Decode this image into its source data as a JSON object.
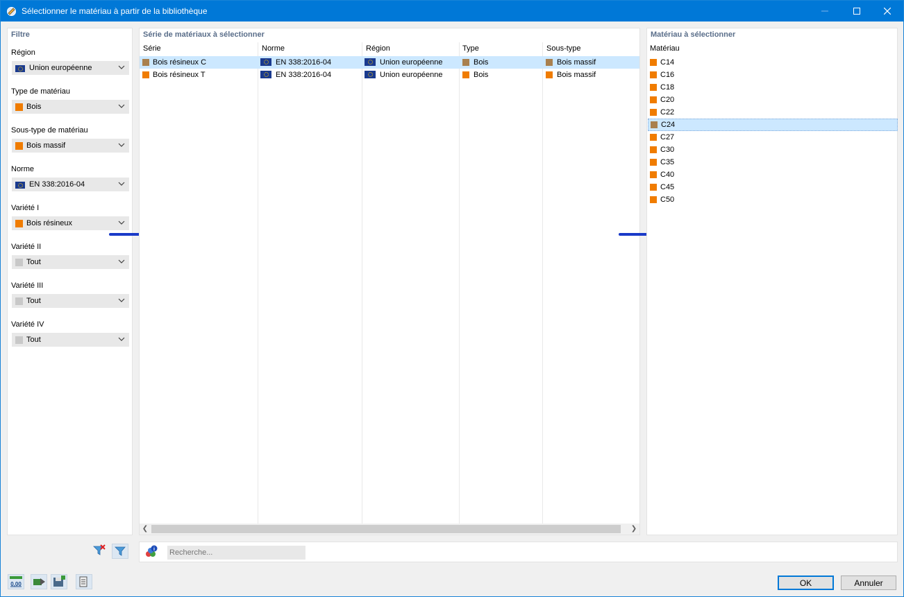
{
  "window": {
    "title": "Sélectionner le matériau à partir de la bibliothèque"
  },
  "filter": {
    "title": "Filtre",
    "fields": [
      {
        "label": "Région",
        "value": "Union européenne",
        "icon": "eu-flag-icon"
      },
      {
        "label": "Type de matériau",
        "value": "Bois",
        "color": "#f07c00"
      },
      {
        "label": "Sous-type de matériau",
        "value": "Bois massif",
        "color": "#f07c00"
      },
      {
        "label": "Norme",
        "value": "EN 338:2016-04",
        "icon": "eu-flag-icon"
      },
      {
        "label": "Variété I",
        "value": "Bois résineux",
        "color": "#f07c00"
      },
      {
        "label": "Variété II",
        "value": "Tout",
        "color": "#c8c8c8"
      },
      {
        "label": "Variété III",
        "value": "Tout",
        "color": "#c8c8c8"
      },
      {
        "label": "Variété IV",
        "value": "Tout",
        "color": "#c8c8c8"
      }
    ]
  },
  "series": {
    "title": "Série de matériaux à sélectionner",
    "columns": [
      "Série",
      "Norme",
      "Région",
      "Type",
      "Sous-type"
    ],
    "rows": [
      {
        "serie": "Bois résineux C",
        "serie_color": "#a9804e",
        "norme": "EN 338:2016-04",
        "region": "Union européenne",
        "type": "Bois",
        "type_color": "#a9804e",
        "soustype": "Bois massif",
        "soustype_color": "#a9804e"
      },
      {
        "serie": "Bois résineux T",
        "serie_color": "#f07c00",
        "norme": "EN 338:2016-04",
        "region": "Union européenne",
        "type": "Bois",
        "type_color": "#f07c00",
        "soustype": "Bois massif",
        "soustype_color": "#f07c00"
      }
    ],
    "selected_row": 0
  },
  "materials": {
    "title": "Matériau à sélectionner",
    "column": "Matériau",
    "items": [
      {
        "name": "C14",
        "color": "#f07c00"
      },
      {
        "name": "C16",
        "color": "#f07c00"
      },
      {
        "name": "C18",
        "color": "#f07c00"
      },
      {
        "name": "C20",
        "color": "#f07c00"
      },
      {
        "name": "C22",
        "color": "#f07c00"
      },
      {
        "name": "C24",
        "color": "#a9804e"
      },
      {
        "name": "C27",
        "color": "#f07c00"
      },
      {
        "name": "C30",
        "color": "#f07c00"
      },
      {
        "name": "C35",
        "color": "#f07c00"
      },
      {
        "name": "C40",
        "color": "#f07c00"
      },
      {
        "name": "C45",
        "color": "#f07c00"
      },
      {
        "name": "C50",
        "color": "#f07c00"
      }
    ],
    "selected_index": 5
  },
  "search": {
    "placeholder": "Recherche..."
  },
  "footer": {
    "ok_label": "OK",
    "cancel_label": "Annuler",
    "units_icon_text": "0,00"
  },
  "colors": {
    "titlebar": "#0078d7",
    "selection": "#cce8ff",
    "arrow": "#1a3ac8"
  }
}
